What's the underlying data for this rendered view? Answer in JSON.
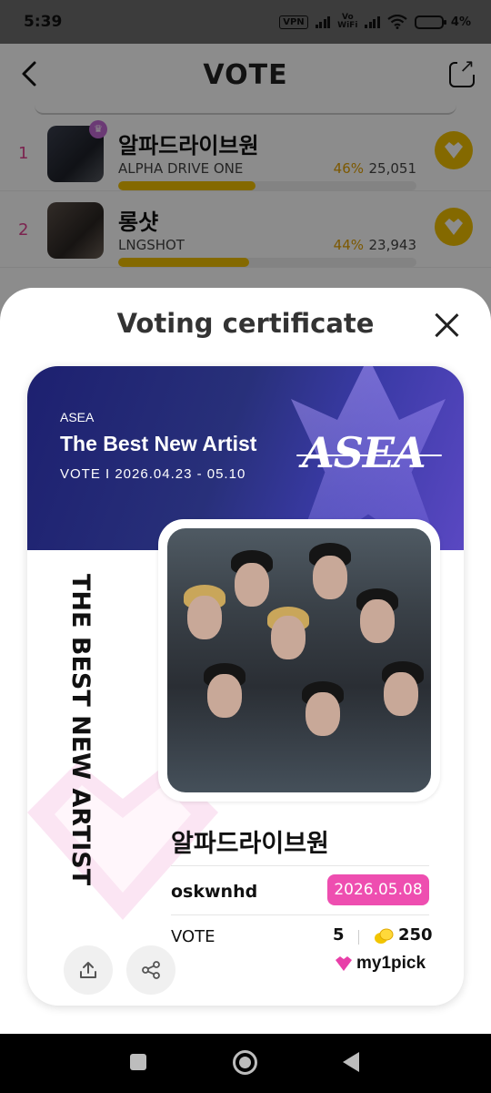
{
  "status": {
    "time": "5:39",
    "vpn": "VPN",
    "vowifi_top": "Vo",
    "vowifi_bottom": "WiFi",
    "battery": "4%"
  },
  "header": {
    "title": "VOTE"
  },
  "ranking": [
    {
      "rank": "1",
      "name": "알파드라이브원",
      "eng": "ALPHA DRIVE ONE",
      "percent": "46%",
      "votes": "25,051",
      "progress": 0.46
    },
    {
      "rank": "2",
      "name": "롱샷",
      "eng": "LNGSHOT",
      "percent": "44%",
      "votes": "23,943",
      "progress": 0.44
    }
  ],
  "sheet": {
    "title": "Voting certificate"
  },
  "certificate": {
    "org": "ASEA",
    "award": "The Best New Artist",
    "dates": "VOTE I 2026.04.23 - 05.10",
    "logo": "ASEA",
    "vertical_title": "THE BEST NEW ARTIST",
    "artist": "알파드라이브원",
    "username": "oskwnhd",
    "date": "2026.05.08",
    "vote_label": "VOTE",
    "vote_count": "5",
    "coin_count": "250",
    "brand": "my1pick"
  },
  "icons": {
    "back": "back-arrow-icon",
    "external": "external-link-icon",
    "close": "close-icon",
    "share": "share-icon",
    "export": "upload-icon"
  },
  "colors": {
    "accent_pink": "#ee4eb0",
    "gold": "#f0c000",
    "banner": "#28307a"
  }
}
